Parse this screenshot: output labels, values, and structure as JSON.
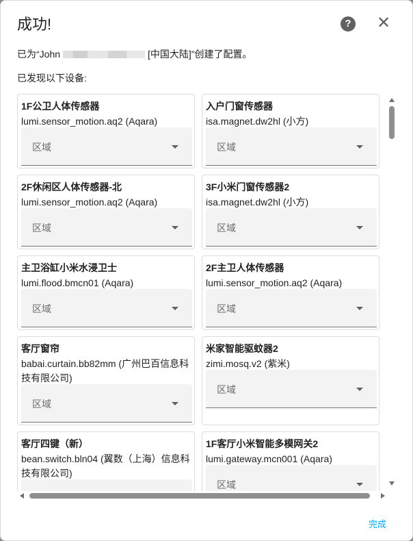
{
  "dialog": {
    "title": "成功!",
    "help_icon": "?",
    "close_icon": "✕",
    "created_prefix": "已为“John",
    "created_suffix": "[中国大陆]”创建了配置。",
    "found_text": "已发现以下设备:",
    "done_label": "完成",
    "accent_color": "#03a9f4"
  },
  "devices": [
    {
      "name": "1F公卫人体传感器",
      "model": "lumi.sensor_motion.aq2 (Aqara)",
      "area_label": "区域"
    },
    {
      "name": "入户门窗传感器",
      "model": "isa.magnet.dw2hl (小方)",
      "area_label": "区域"
    },
    {
      "name": "2F休闲区人体传感器-北",
      "model": "lumi.sensor_motion.aq2 (Aqara)",
      "area_label": "区域"
    },
    {
      "name": "3F小米门窗传感器2",
      "model": "isa.magnet.dw2hl (小方)",
      "area_label": "区域"
    },
    {
      "name": "主卫浴缸小米水浸卫士",
      "model": "lumi.flood.bmcn01 (Aqara)",
      "area_label": "区域"
    },
    {
      "name": "2F主卫人体传感器",
      "model": "lumi.sensor_motion.aq2 (Aqara)",
      "area_label": "区域"
    },
    {
      "name": "客厅窗帘",
      "model": "babai.curtain.bb82mm (广州巴百信息科技有限公司)",
      "area_label": "区域"
    },
    {
      "name": "米家智能驱蚊器2",
      "model": "zimi.mosq.v2 (紫米)",
      "area_label": "区域"
    },
    {
      "name": "客厅四键（新）",
      "model": "bean.switch.bln04 (翼数（上海）信息科技有限公司)",
      "area_label": "区域"
    },
    {
      "name": "1F客厅小米智能多模网关2",
      "model": "lumi.gateway.mcn001 (Aqara)",
      "area_label": "区域"
    }
  ]
}
